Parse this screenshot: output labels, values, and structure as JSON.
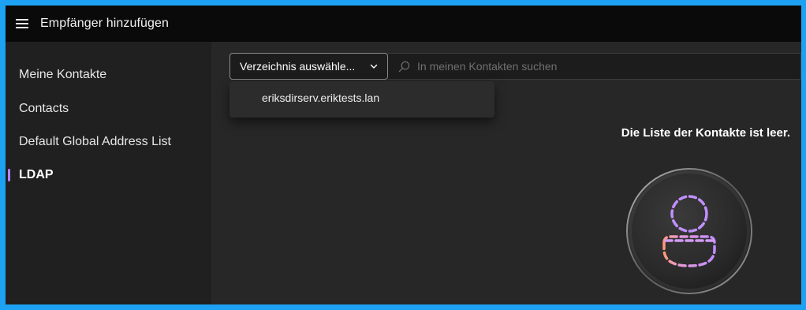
{
  "header": {
    "title": "Empfänger hinzufügen",
    "menu_icon": "hamburger-icon"
  },
  "sidebar": {
    "items": [
      {
        "label": "Meine Kontakte",
        "active": false
      },
      {
        "label": "Contacts",
        "active": false
      },
      {
        "label": "Default Global Address List",
        "active": false
      },
      {
        "label": "LDAP",
        "active": true
      }
    ],
    "accent_color": "#b583ff"
  },
  "toolbar": {
    "directory_select": {
      "value": "Verzeichnis auswähle...",
      "icon": "chevron-down-icon"
    },
    "search": {
      "placeholder": "In meinen Kontakten suchen",
      "value": "",
      "icon": "search-icon"
    }
  },
  "dropdown": {
    "items": [
      {
        "label": "eriksdirserv.eriktests.lan"
      }
    ]
  },
  "main": {
    "empty_message": "Die Liste der Kontakte ist leer.",
    "illustration_icon": "person-placeholder-icon"
  }
}
